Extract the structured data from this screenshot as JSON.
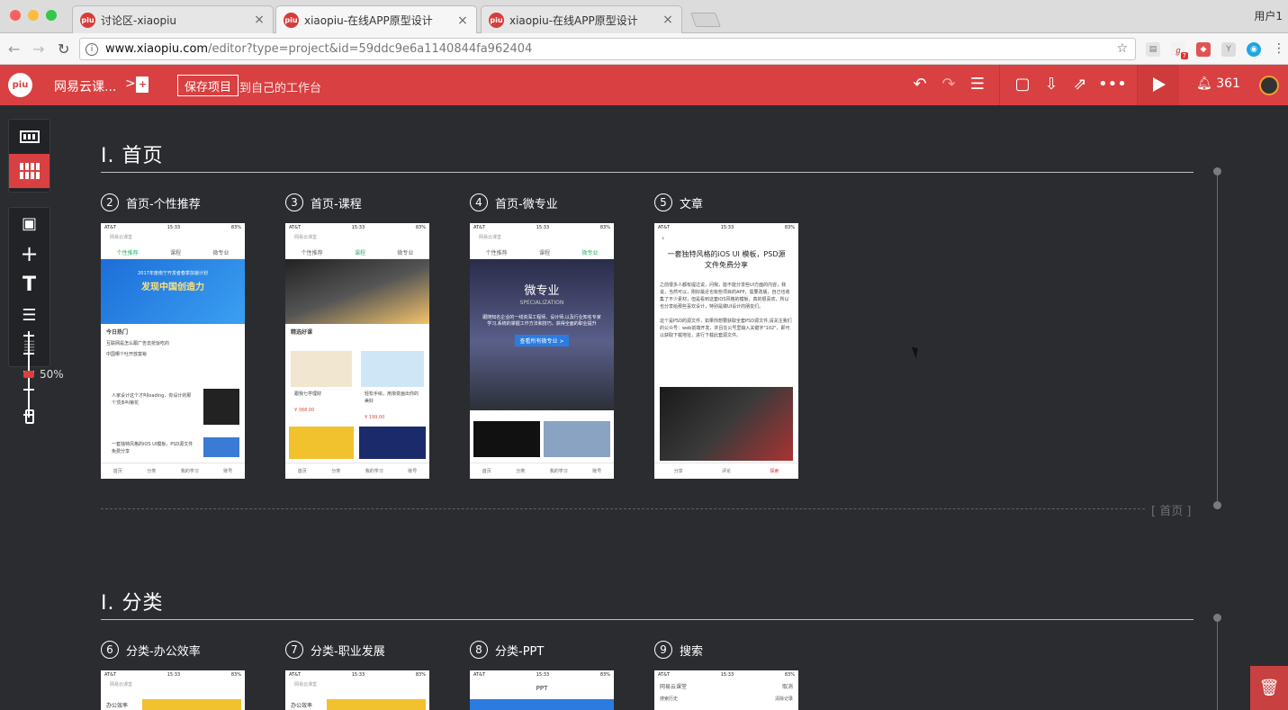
{
  "browser": {
    "tabs": [
      {
        "label": "讨论区-xiaopiu",
        "active": false
      },
      {
        "label": "xiaopiu-在线APP原型设计",
        "active": true
      },
      {
        "label": "xiaopiu-在线APP原型设计",
        "active": false
      }
    ],
    "user": "用户1",
    "url_host": "www.xiaopiu.com",
    "url_path": "/editor?type=project&id=59ddc9e6a1140844fa962404",
    "favicon": "piu",
    "ext_badge": "7"
  },
  "toolbar": {
    "logo": "piu",
    "project_name": "网易云课...",
    "project_arrow": ">",
    "save_label": "保存项目",
    "save_note": "到自己的工作台",
    "notifications": "361",
    "accent": "#d94041"
  },
  "left_panel": {
    "zoom": "50%",
    "zoom_value": 0.5
  },
  "sections": [
    {
      "title": "I. 首页",
      "end_label": "[ 首页 ]",
      "pages": [
        {
          "num": "2",
          "label": "首页-个性推荐"
        },
        {
          "num": "3",
          "label": "首页-课程"
        },
        {
          "num": "4",
          "label": "首页-微专业"
        },
        {
          "num": "5",
          "label": "文章"
        }
      ]
    },
    {
      "title": "I. 分类",
      "pages": [
        {
          "num": "6",
          "label": "分类-办公效率"
        },
        {
          "num": "7",
          "label": "分类-职业发展"
        },
        {
          "num": "8",
          "label": "分类-PPT"
        },
        {
          "num": "9",
          "label": "搜索"
        }
      ]
    }
  ],
  "phones": {
    "status_carrier": "AT&T",
    "status_time": "15:33",
    "status_battery": "83%",
    "search": "网易云课堂",
    "tabs": [
      "个性推荐",
      "课程",
      "微专业"
    ],
    "bottom_nav": [
      "首页",
      "分类",
      "我的学习",
      "账号"
    ],
    "p2": {
      "banner_line1": "2017年度南宁开发者春季加速计划",
      "banner_title": "发现中国创造力",
      "hot_title": "今日热门",
      "hot_items": [
        "互联网是怎么跟广告去抢饭吃的",
        "中国哪个吐开放富裕"
      ],
      "article1": "人家设计这个才叫loading，你设计的那个顶多叫菊花",
      "article2": "一套独特风格的iOS UI模板，PSD源文件免费分享"
    },
    "p3": {
      "section": "精选好课",
      "course1": "跟我七学理财",
      "course2": "轻松手绘，用渐变画出你的美好",
      "price1": "¥ 368.00",
      "price2": "¥ 199.00"
    },
    "p4": {
      "title": "微专业",
      "subtitle": "SPECIALIZATION",
      "desc": "跟随知名企业的一线资深工程师、设计师,以及行业知名专家学习,系统的掌握工作方法和技巧，获得全面的职业提升",
      "button": "查看所有微专业 >"
    },
    "p5": {
      "title": "一套独特风格的iOS UI 模板，PSD源文件免费分享",
      "para1": "之前很多人都有提过说，问我，能不能分享些UI方面的内容，我说，当然可以，刚好最近也有些项目的APP，需要改版，自己也收集了不少素材，但是看到这套iOS风格的模板，真的很喜欢，所以也分享给那些喜欢设计，特别是做UI设计的朋友们。",
      "para2": "这个是PSD的源文件，如果你想要获取全套PSD源文件,请关注我们的公众号：web前端开发，并且在公号里输入关键字\"102\"，即可以获取下载地址，进行下载此套源文件。",
      "actions": [
        "分享",
        "评论",
        "探索"
      ]
    },
    "p6": {
      "side": "办公效率"
    },
    "p7": {
      "side": "办公效率"
    },
    "p8": {
      "title": "PPT"
    },
    "p9": {
      "history": "搜索历史",
      "cancel": "取消",
      "clear": "清除记录"
    }
  }
}
